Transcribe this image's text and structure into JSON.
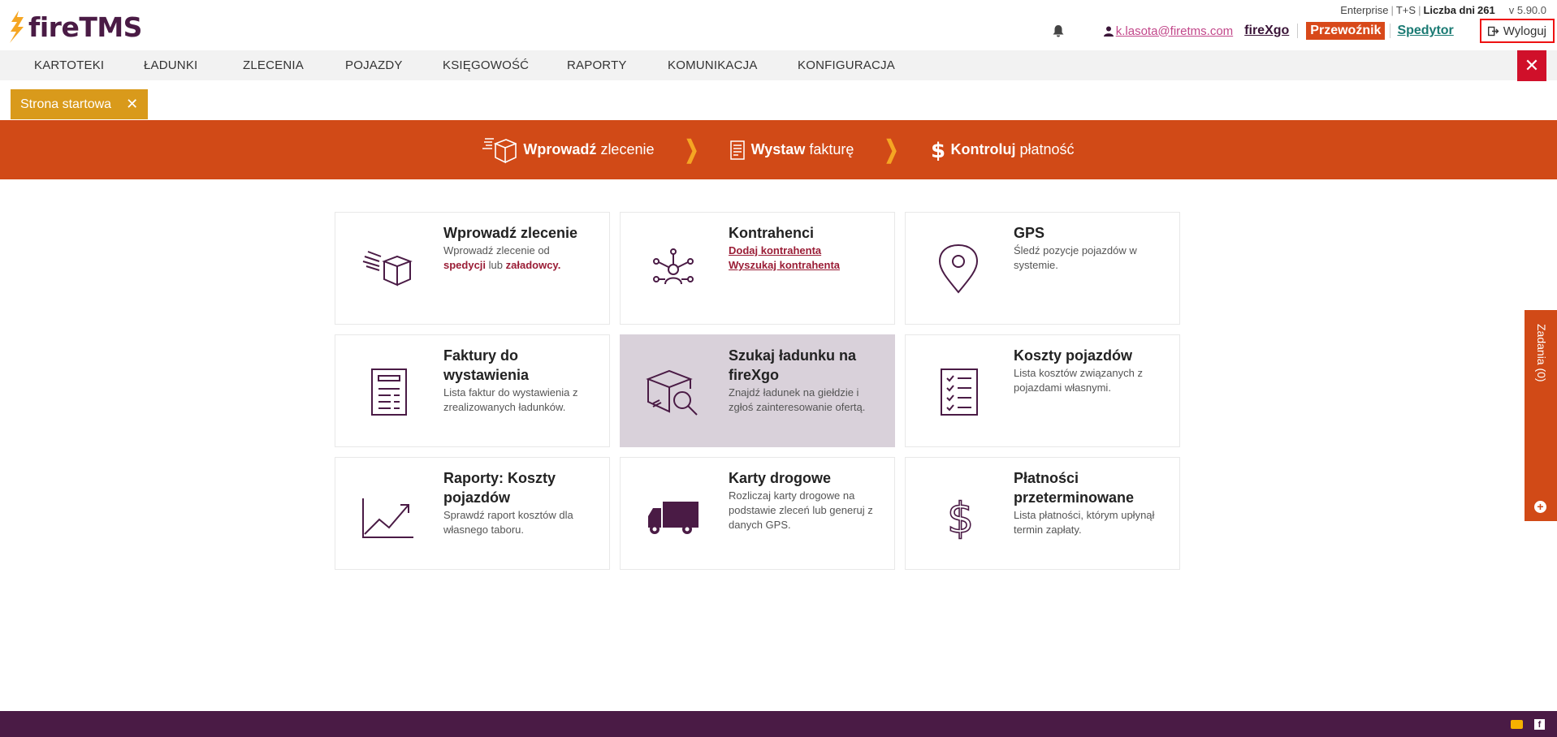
{
  "brand": {
    "name": "fireTMS",
    "accent": "#d14a17",
    "dark": "#4a1b45",
    "gold": "#d99a1b"
  },
  "meta": {
    "edition": "Enterprise",
    "mode": "T+S",
    "days_label": "Liczba dni",
    "days_value": "261",
    "version": "v 5.90.0"
  },
  "user": {
    "email": "k.lasota@firetms.com",
    "firexgo": "fireXgo",
    "przewoznik": "Przewoźnik",
    "spedytor": "Spedytor",
    "logout": "Wyloguj"
  },
  "nav": {
    "items": [
      "KARTOTEKI",
      "ŁADUNKI",
      "ZLECENIA",
      "POJAZDY",
      "KSIĘGOWOŚĆ",
      "RAPORTY",
      "KOMUNIKACJA",
      "KONFIGURACJA"
    ]
  },
  "tab": {
    "label": "Strona startowa"
  },
  "banner": {
    "steps": [
      {
        "bold": "Wprowadź",
        "rest": "zlecenie"
      },
      {
        "bold": "Wystaw",
        "rest": "fakturę"
      },
      {
        "bold": "Kontroluj",
        "rest": "płatność"
      }
    ]
  },
  "tiles": [
    {
      "title": "Wprowadź zlecenie",
      "desc_pre": "Wprowadź zlecenie od",
      "hl1": "spedycji",
      "mid": "lub",
      "hl2": "załadowcy."
    },
    {
      "title": "Kontrahenci",
      "link1": "Dodaj kontrahenta",
      "link2": "Wyszukaj kontrahenta"
    },
    {
      "title": "GPS",
      "desc": "Śledź pozycje pojazdów w systemie."
    },
    {
      "title": "Faktury do wystawienia",
      "desc": "Lista faktur do wystawienia z zrealizowanych ładunków."
    },
    {
      "title": "Szukaj ładunku na fireXgo",
      "desc": "Znajdź ładunek na giełdzie i zgłoś zainteresowanie ofertą."
    },
    {
      "title": "Koszty pojazdów",
      "desc": "Lista kosztów związanych z pojazdami własnymi."
    },
    {
      "title": "Raporty: Koszty pojazdów",
      "desc": "Sprawdź raport kosztów dla własnego taboru."
    },
    {
      "title": "Karty drogowe",
      "desc": "Rozliczaj karty drogowe na podstawie zleceń lub generuj z danych GPS."
    },
    {
      "title": "Płatności przeterminowane",
      "desc": "Lista płatności, którym upłynął termin zapłaty."
    }
  ],
  "side": {
    "label": "Zadania (0)",
    "plus": "+"
  },
  "icons": [
    "flame-logo-icon",
    "bell-icon",
    "user-icon",
    "logout-icon",
    "close-icon",
    "box-icon",
    "invoice-icon",
    "dollar-icon",
    "network-icon",
    "map-pin-icon",
    "document-icon",
    "box-search-icon",
    "checklist-icon",
    "chart-trend-icon",
    "truck-icon",
    "mail-icon",
    "facebook-icon"
  ]
}
